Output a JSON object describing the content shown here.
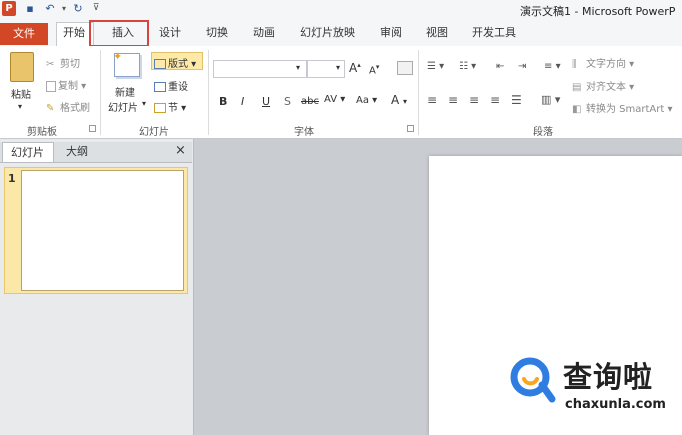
{
  "window": {
    "title": "演示文稿1 - Microsoft PowerP"
  },
  "tabs": {
    "file": "文件",
    "home": "开始",
    "insert": "插入",
    "design": "设计",
    "transitions": "切换",
    "animations": "动画",
    "slideshow": "幻灯片放映",
    "review": "审阅",
    "view": "视图",
    "developer": "开发工具"
  },
  "ribbon": {
    "clipboard": {
      "paste": "粘贴",
      "cut": "剪切",
      "copy": "复制",
      "format_painter": "格式刷",
      "label": "剪贴板"
    },
    "slides": {
      "new_slide_line1": "新建",
      "new_slide_line2": "幻灯片",
      "layout": "版式",
      "reset": "重设",
      "section": "节",
      "label": "幻灯片"
    },
    "font": {
      "bold": "B",
      "italic": "I",
      "underline": "U",
      "shadow": "S",
      "strike": "abc",
      "spacing": "AV",
      "case": "Aa",
      "color": "A",
      "grow": "A",
      "shrink": "A",
      "label": "字体"
    },
    "paragraph": {
      "text_direction": "文字方向",
      "align_text": "对齐文本",
      "smartart": "转换为 SmartArt",
      "label": "段落"
    }
  },
  "left_panel": {
    "tab_slides": "幻灯片",
    "tab_outline": "大纲",
    "close": "×",
    "slide_number": "1"
  },
  "watermark": {
    "cn": "查询啦",
    "en": "chaxunla.com"
  },
  "colors": {
    "file_tab": "#d24726",
    "highlight_box": "#d9423f",
    "thumb_selected": "#fbe7a7",
    "watermark_blue": "#2f7de1",
    "watermark_orange": "#f5a623"
  }
}
